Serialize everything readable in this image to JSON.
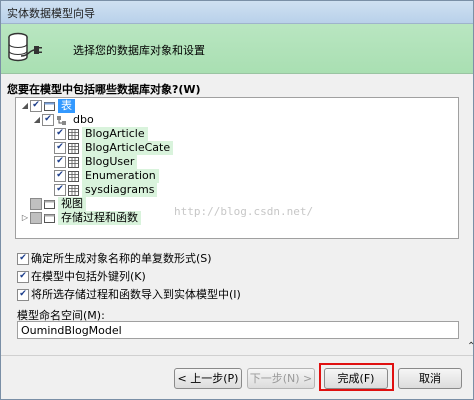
{
  "window": {
    "title": "实体数据模型向导"
  },
  "banner": {
    "text": "选择您的数据库对象和设置"
  },
  "question": "您要在模型中包括哪些数据库对象?(W)",
  "tree": {
    "root": "表",
    "schema": "dbo",
    "tables": [
      "BlogArticle",
      "BlogArticleCate",
      "BlogUser",
      "Enumeration",
      "sysdiagrams"
    ],
    "views": "视图",
    "procs": "存储过程和函数"
  },
  "watermark": "http://blog.csdn.net/",
  "options": [
    {
      "label": "确定所生成对象名称的单复数形式(S)",
      "checked": true
    },
    {
      "label": "在模型中包括外键列(K)",
      "checked": true
    },
    {
      "label": "将所选存储过程和函数导入到实体模型中(I)",
      "checked": true
    }
  ],
  "namespace": {
    "label": "模型命名空间(M):",
    "value": "OumindBlogModel"
  },
  "buttons": {
    "prev": "< 上一步(P)",
    "next": "下一步(N) >",
    "finish": "完成(F)",
    "cancel": "取消"
  },
  "colors": {
    "banner": "#b9e6c1",
    "selection": "#3399ff",
    "highlight_box": "#e01010"
  }
}
